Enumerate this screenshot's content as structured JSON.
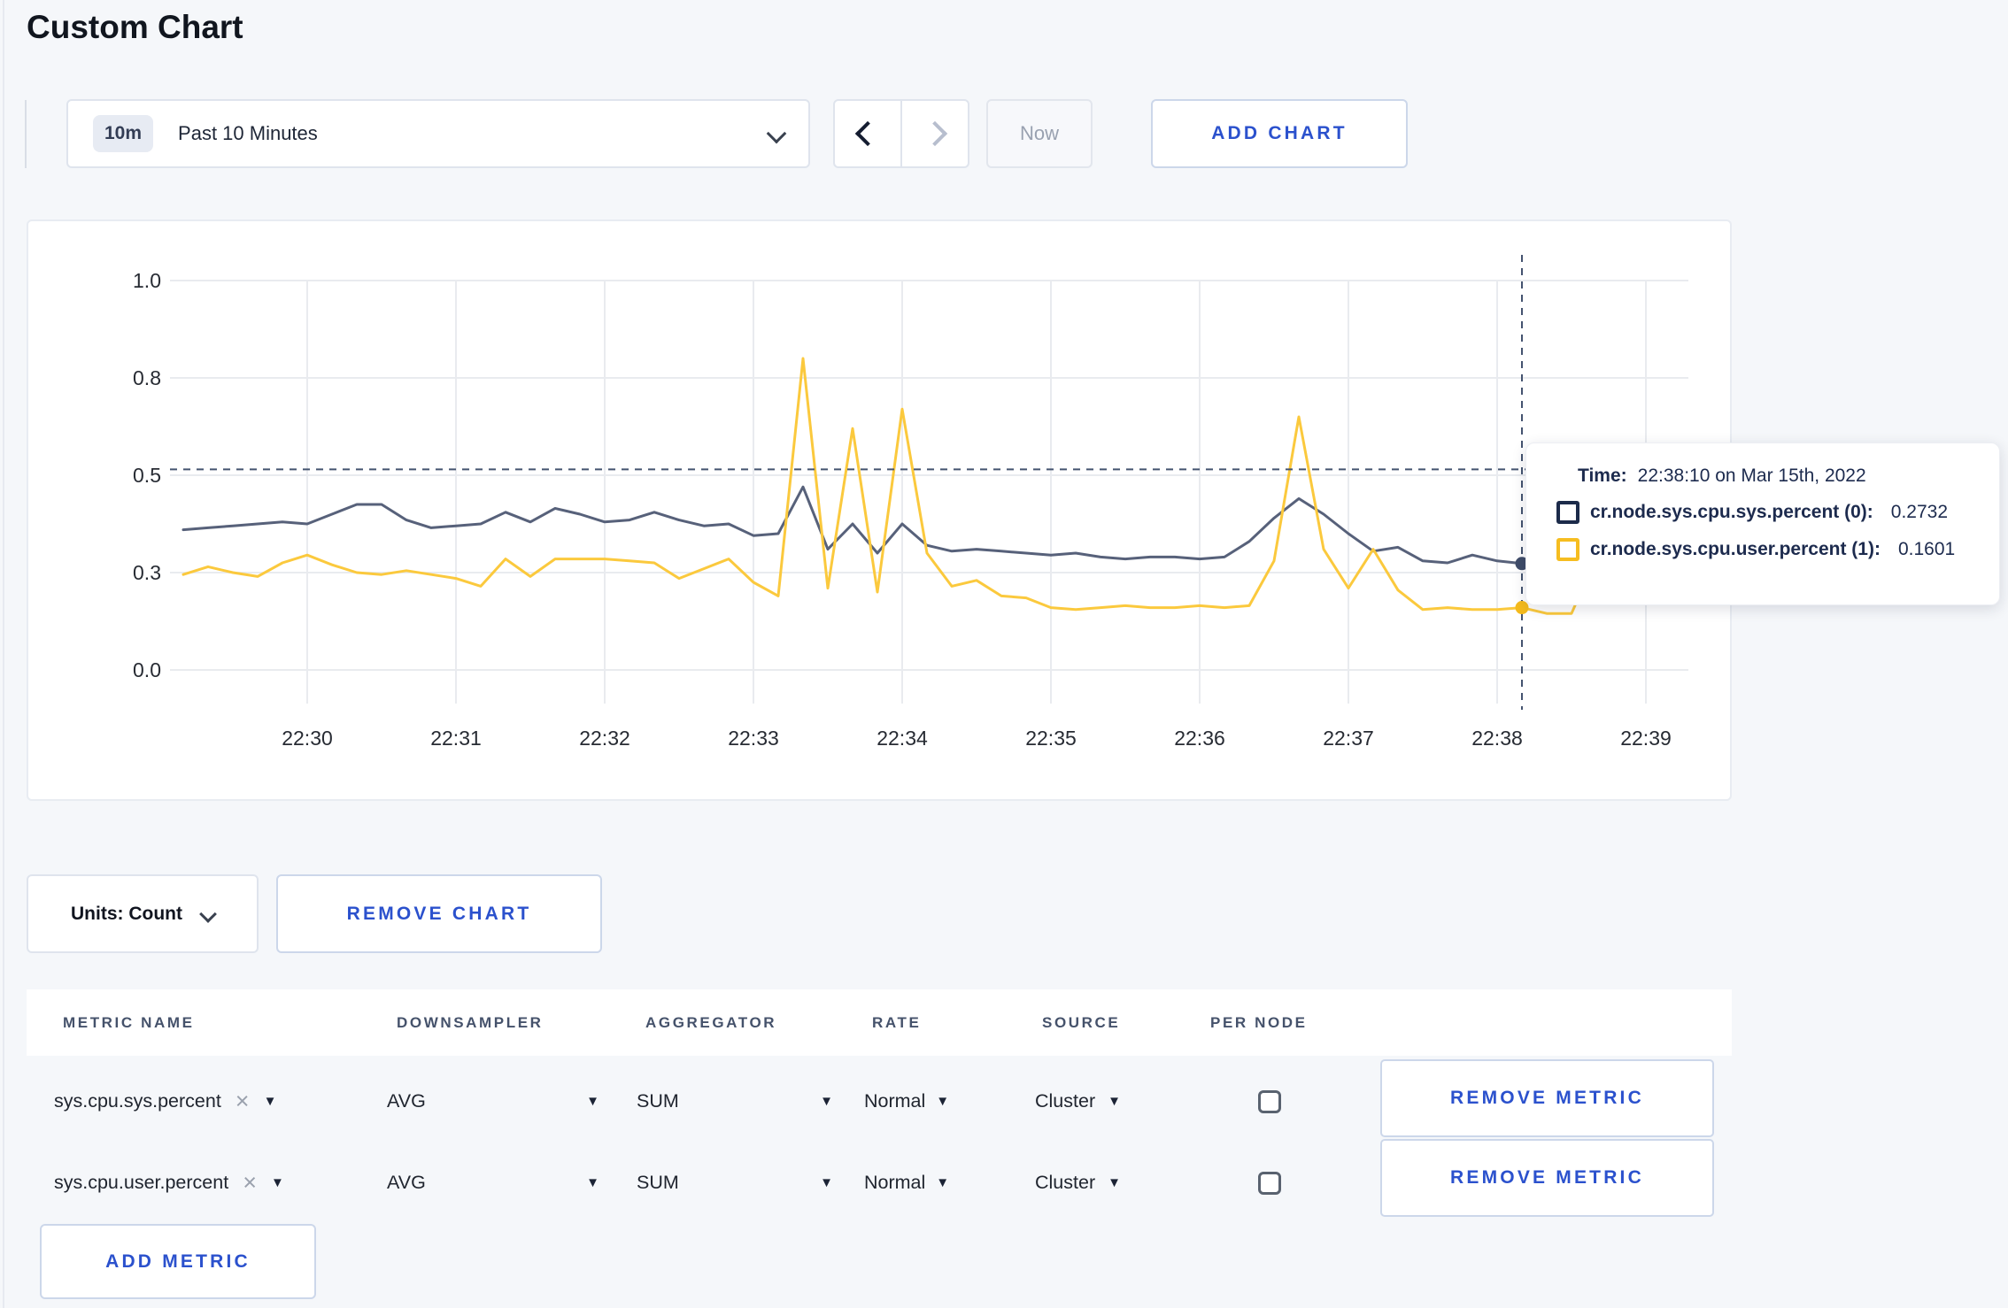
{
  "page": {
    "title": "Custom Chart",
    "accent_blue": "#2b51cd",
    "background": "#f5f7fa"
  },
  "toolbar": {
    "time_range_badge": "10m",
    "time_range_label": "Past 10 Minutes",
    "prev_icon": "chevron-left",
    "next_icon": "chevron-right",
    "now_label": "Now",
    "add_chart_label": "ADD CHART"
  },
  "tooltip": {
    "time_label": "Time:",
    "time_value": "22:38:10 on Mar 15th, 2022",
    "series": [
      {
        "label": "cr.node.sys.cpu.sys.percent (0):",
        "value": "0.2732",
        "color": "#1c2b4a"
      },
      {
        "label": "cr.node.sys.cpu.user.percent (1):",
        "value": "0.1601",
        "color": "#f6bd20"
      }
    ]
  },
  "chart_footer": {
    "units_label": "Units: Count",
    "remove_chart_label": "REMOVE CHART"
  },
  "metrics_table": {
    "headers": [
      "METRIC NAME",
      "DOWNSAMPLER",
      "AGGREGATOR",
      "RATE",
      "SOURCE",
      "PER NODE"
    ],
    "rows": [
      {
        "metric": "sys.cpu.sys.percent",
        "downsampler": "AVG",
        "aggregator": "SUM",
        "rate": "Normal",
        "source": "Cluster",
        "per_node_checked": false,
        "remove_label": "REMOVE METRIC"
      },
      {
        "metric": "sys.cpu.user.percent",
        "downsampler": "AVG",
        "aggregator": "SUM",
        "rate": "Normal",
        "source": "Cluster",
        "per_node_checked": false,
        "remove_label": "REMOVE METRIC"
      }
    ],
    "add_metric_label": "ADD METRIC"
  },
  "chart_data": {
    "type": "line",
    "title": "",
    "xlabel": "",
    "ylabel": "",
    "ylim": [
      0,
      1
    ],
    "grid": true,
    "legend_position": "tooltip",
    "y_ticks": [
      "0.0",
      "0.3",
      "0.5",
      "0.8",
      "1.0"
    ],
    "y_tick_values": [
      0,
      0.25,
      0.5,
      0.75,
      1.0
    ],
    "x_ticks": [
      "22:30",
      "22:31",
      "22:32",
      "22:33",
      "22:34",
      "22:35",
      "22:36",
      "22:37",
      "22:38",
      "22:39"
    ],
    "x": [
      "22:29:10",
      "22:29:20",
      "22:29:30",
      "22:29:40",
      "22:29:50",
      "22:30:00",
      "22:30:10",
      "22:30:20",
      "22:30:30",
      "22:30:40",
      "22:30:50",
      "22:31:00",
      "22:31:10",
      "22:31:20",
      "22:31:30",
      "22:31:40",
      "22:31:50",
      "22:32:00",
      "22:32:10",
      "22:32:20",
      "22:32:30",
      "22:32:40",
      "22:32:50",
      "22:33:00",
      "22:33:10",
      "22:33:20",
      "22:33:30",
      "22:33:40",
      "22:33:50",
      "22:34:00",
      "22:34:10",
      "22:34:20",
      "22:34:30",
      "22:34:40",
      "22:34:50",
      "22:35:00",
      "22:35:10",
      "22:35:20",
      "22:35:30",
      "22:35:40",
      "22:35:50",
      "22:36:00",
      "22:36:10",
      "22:36:20",
      "22:36:30",
      "22:36:40",
      "22:36:50",
      "22:37:00",
      "22:37:10",
      "22:37:20",
      "22:37:30",
      "22:37:40",
      "22:37:50",
      "22:38:00",
      "22:38:10",
      "22:38:20",
      "22:38:30",
      "22:38:40",
      "22:38:50",
      "22:39:00",
      "22:39:10"
    ],
    "series": [
      {
        "name": "cr.node.sys.cpu.sys.percent (0)",
        "color": "#57617a",
        "dot_color": "#3f4c69",
        "hover_value": 0.2732,
        "values": [
          0.36,
          0.365,
          0.37,
          0.375,
          0.38,
          0.375,
          0.4,
          0.425,
          0.425,
          0.385,
          0.365,
          0.37,
          0.375,
          0.405,
          0.38,
          0.415,
          0.4,
          0.38,
          0.385,
          0.405,
          0.385,
          0.37,
          0.375,
          0.345,
          0.35,
          0.47,
          0.31,
          0.375,
          0.3,
          0.375,
          0.32,
          0.305,
          0.31,
          0.305,
          0.3,
          0.295,
          0.3,
          0.29,
          0.285,
          0.29,
          0.29,
          0.285,
          0.29,
          0.33,
          0.39,
          0.44,
          0.4,
          0.35,
          0.305,
          0.315,
          0.28,
          0.275,
          0.295,
          0.28,
          0.2732,
          0.28,
          0.285,
          0.295,
          0.31,
          0.3,
          0.31
        ]
      },
      {
        "name": "cr.node.sys.cpu.user.percent (1)",
        "color": "#fbc93d",
        "dot_color": "#f5bb1d",
        "hover_value": 0.1601,
        "values": [
          0.245,
          0.265,
          0.25,
          0.24,
          0.275,
          0.295,
          0.27,
          0.25,
          0.245,
          0.255,
          0.245,
          0.235,
          0.215,
          0.285,
          0.24,
          0.285,
          0.285,
          0.285,
          0.28,
          0.275,
          0.235,
          0.26,
          0.285,
          0.225,
          0.19,
          0.8,
          0.21,
          0.62,
          0.2,
          0.67,
          0.3,
          0.215,
          0.23,
          0.19,
          0.185,
          0.16,
          0.155,
          0.16,
          0.165,
          0.16,
          0.16,
          0.165,
          0.16,
          0.165,
          0.28,
          0.65,
          0.31,
          0.21,
          0.31,
          0.205,
          0.155,
          0.16,
          0.155,
          0.155,
          0.1601,
          0.145,
          0.145,
          0.29,
          0.22,
          0.27,
          0.23
        ]
      }
    ],
    "crosshair": {
      "time": "22:38:10",
      "value": 0.515
    }
  }
}
